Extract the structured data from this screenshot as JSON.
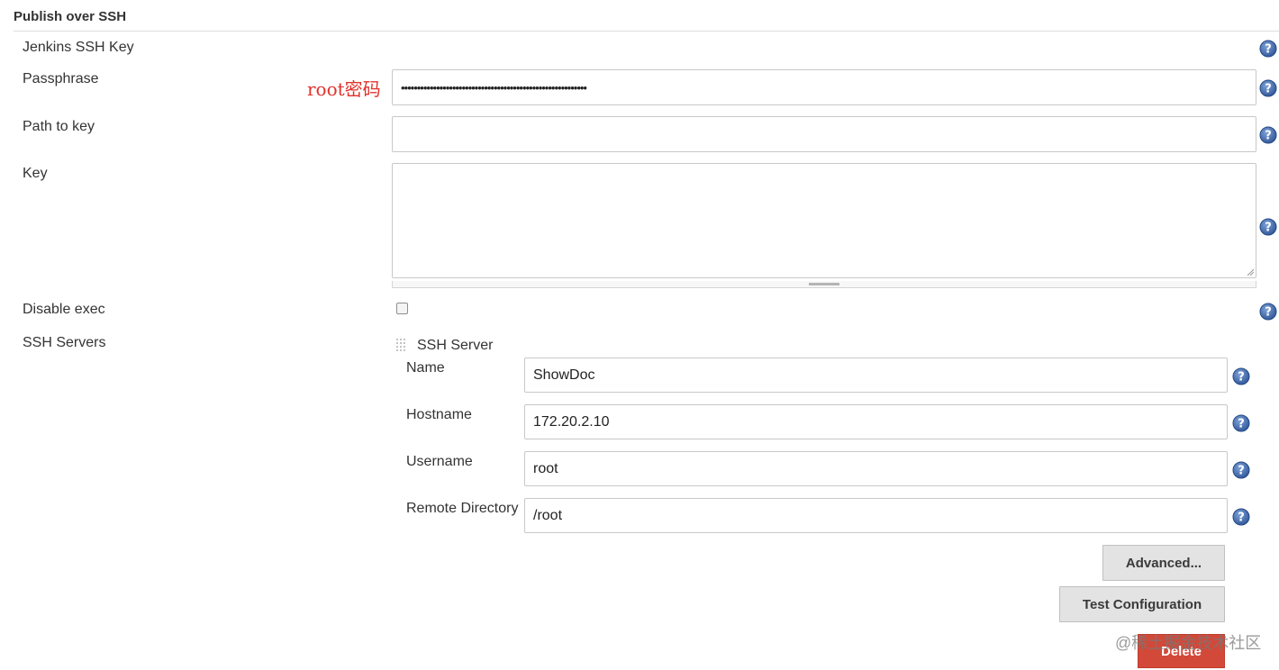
{
  "section": {
    "title": "Publish over SSH"
  },
  "fields": {
    "jenkins_ssh_key_label": "Jenkins SSH Key",
    "passphrase_label": "Passphrase",
    "passphrase_value": "••••••••••••••••••••••••••••••••••••••••••••••••••••••••••",
    "path_to_key_label": "Path to key",
    "path_to_key_value": "",
    "key_label": "Key",
    "key_value": "",
    "disable_exec_label": "Disable exec",
    "disable_exec_checked": false,
    "ssh_servers_label": "SSH Servers"
  },
  "annotation": {
    "text": "root密码",
    "color": "#e0322b"
  },
  "ssh_server": {
    "header": "SSH Server",
    "name_label": "Name",
    "name_value": "ShowDoc",
    "hostname_label": "Hostname",
    "hostname_value": "172.20.2.10",
    "username_label": "Username",
    "username_value": "root",
    "remote_directory_label": "Remote Directory",
    "remote_directory_value": "/root"
  },
  "buttons": {
    "advanced": "Advanced...",
    "test_configuration": "Test Configuration",
    "delete": "Delete"
  },
  "watermark": "@稀土掘金技术社区",
  "icons": {
    "help": "help-icon",
    "drag": "drag-handle-icon"
  },
  "colors": {
    "help_blue": "#4a73b5",
    "delete_red": "#d24939"
  }
}
